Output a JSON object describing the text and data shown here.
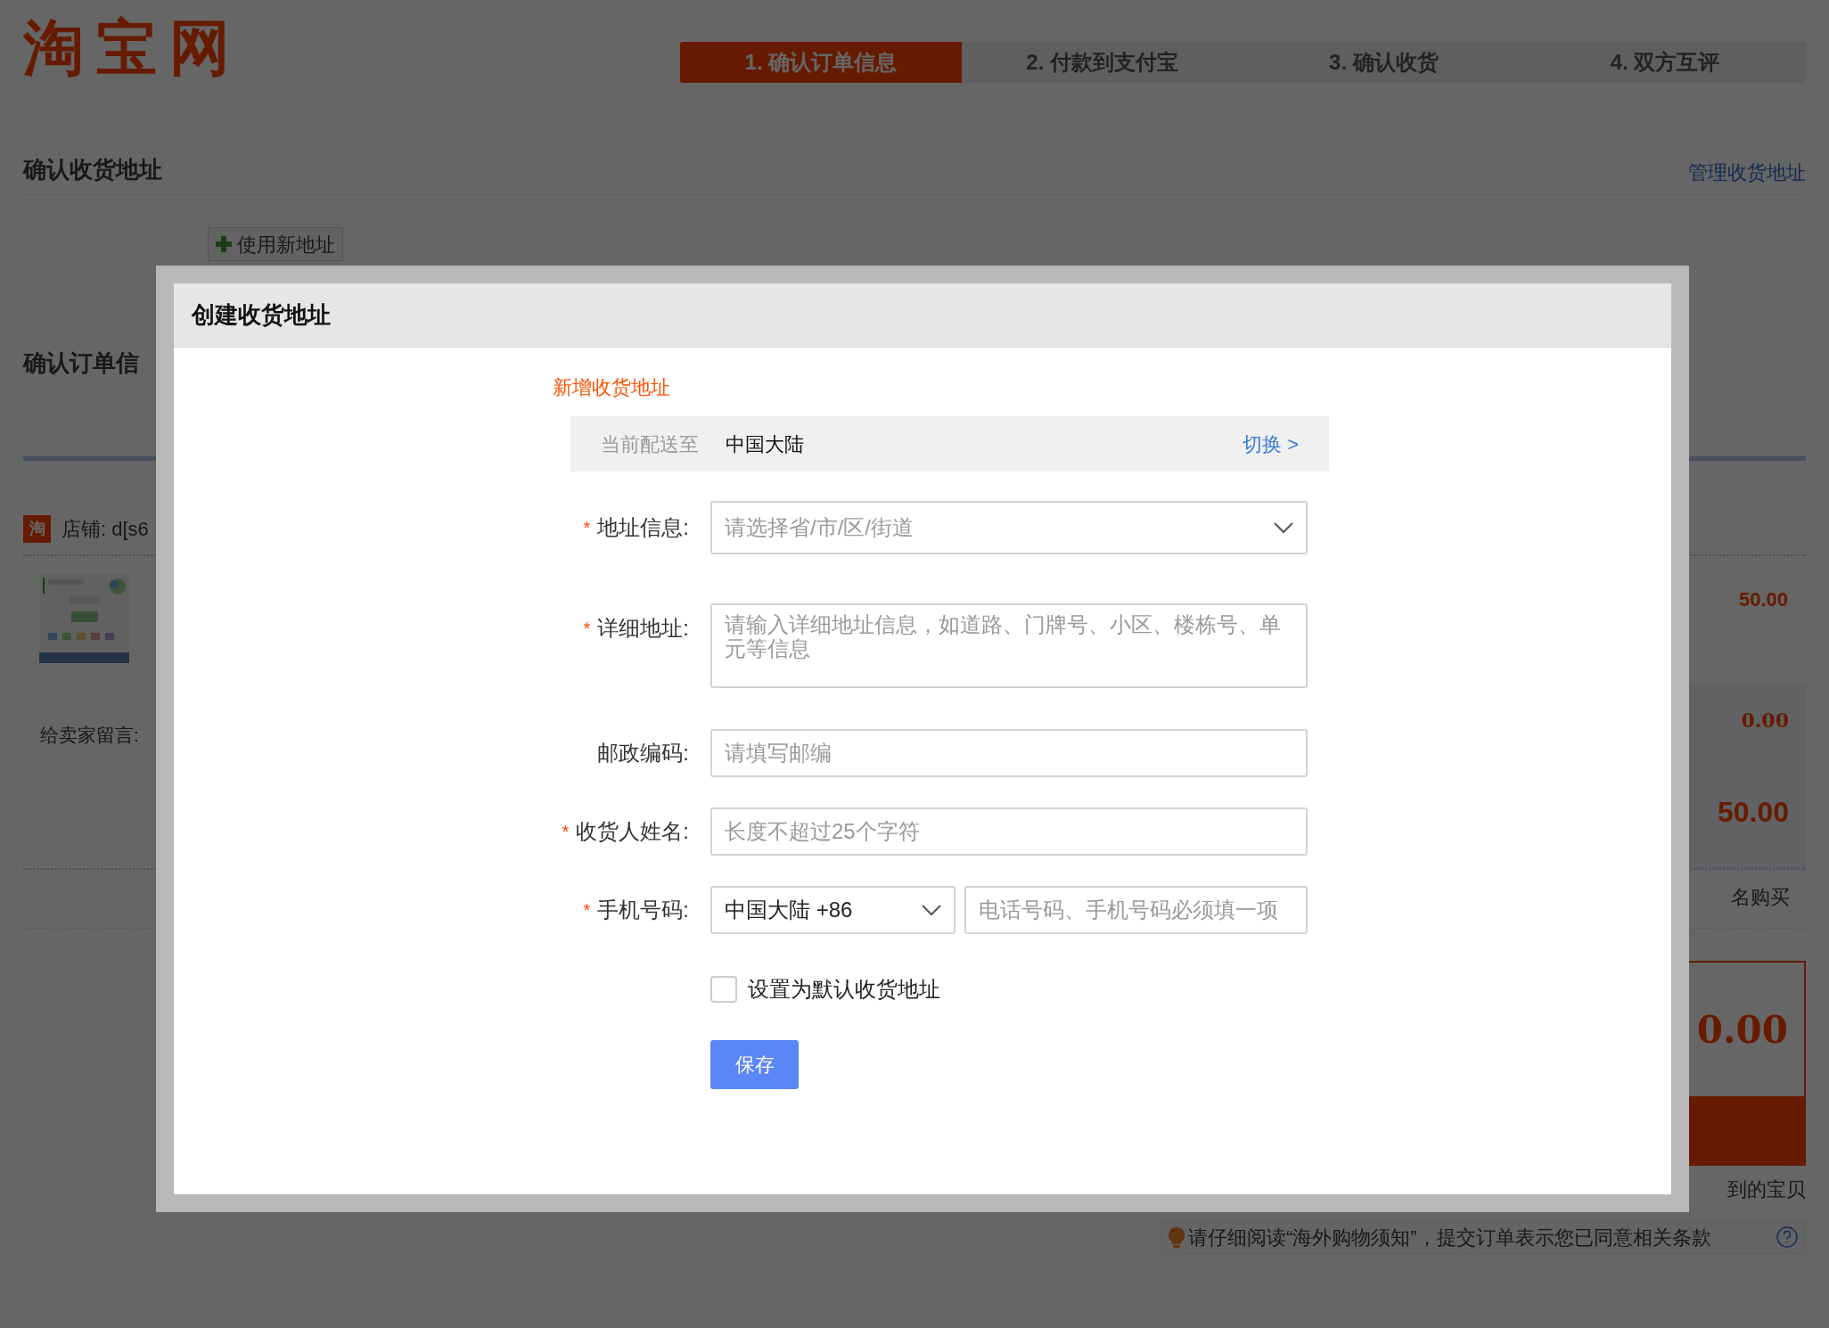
{
  "page": {
    "logo": "淘宝网",
    "steps": [
      {
        "label": "1. 确认订单信息",
        "selected": true
      },
      {
        "label": "2. 付款到支付宝",
        "selected": false
      },
      {
        "label": "3. 确认收货",
        "selected": false
      },
      {
        "label": "4. 双方互评",
        "selected": false
      }
    ],
    "address_section": {
      "title": "确认收货地址",
      "manage_link": "管理收货地址",
      "new_address_button": "使用新地址"
    },
    "order_section": {
      "title": "确认订单信",
      "shop_badge": "淘",
      "shop_label": "店铺: d[s6",
      "message_label": "给卖家留言:",
      "price": "50.00",
      "discount": "0.00",
      "subtotal": "50.00",
      "anonymous_label": "名购买",
      "total": "0.00",
      "bought_link": "到的宝贝"
    },
    "notice": "请仔细阅读“海外购物须知”，提交订单表示您已同意相关条款"
  },
  "dialog": {
    "title": "创建收货地址",
    "subtitle": "新增收货地址",
    "destination": {
      "label": "当前配送至",
      "value": "中国大陆",
      "switch_link": "切换 >"
    },
    "fields": [
      {
        "kind": "select",
        "required_mark": "*",
        "label": "地址信息:",
        "placeholder": "请选择省/市/区/街道"
      },
      {
        "kind": "textarea",
        "required_mark": "*",
        "label": "详细地址:",
        "placeholder": "请输入详细地址信息，如道路、门牌号、小区、楼栋号、单元等信息"
      },
      {
        "kind": "input",
        "label": "邮政编码:",
        "placeholder": "请填写邮编"
      },
      {
        "kind": "input",
        "required_mark": "*",
        "label": "收货人姓名:",
        "placeholder": "长度不超过25个字符"
      },
      {
        "kind": "phone",
        "required_mark": "*",
        "label": "手机号码:",
        "country_code": "中国大陆 +86",
        "placeholder": "电话号码、手机号码必须填一项"
      }
    ],
    "default_checkbox": {
      "label": "设置为默认收货地址",
      "checked": false
    },
    "save_button": "保存"
  }
}
